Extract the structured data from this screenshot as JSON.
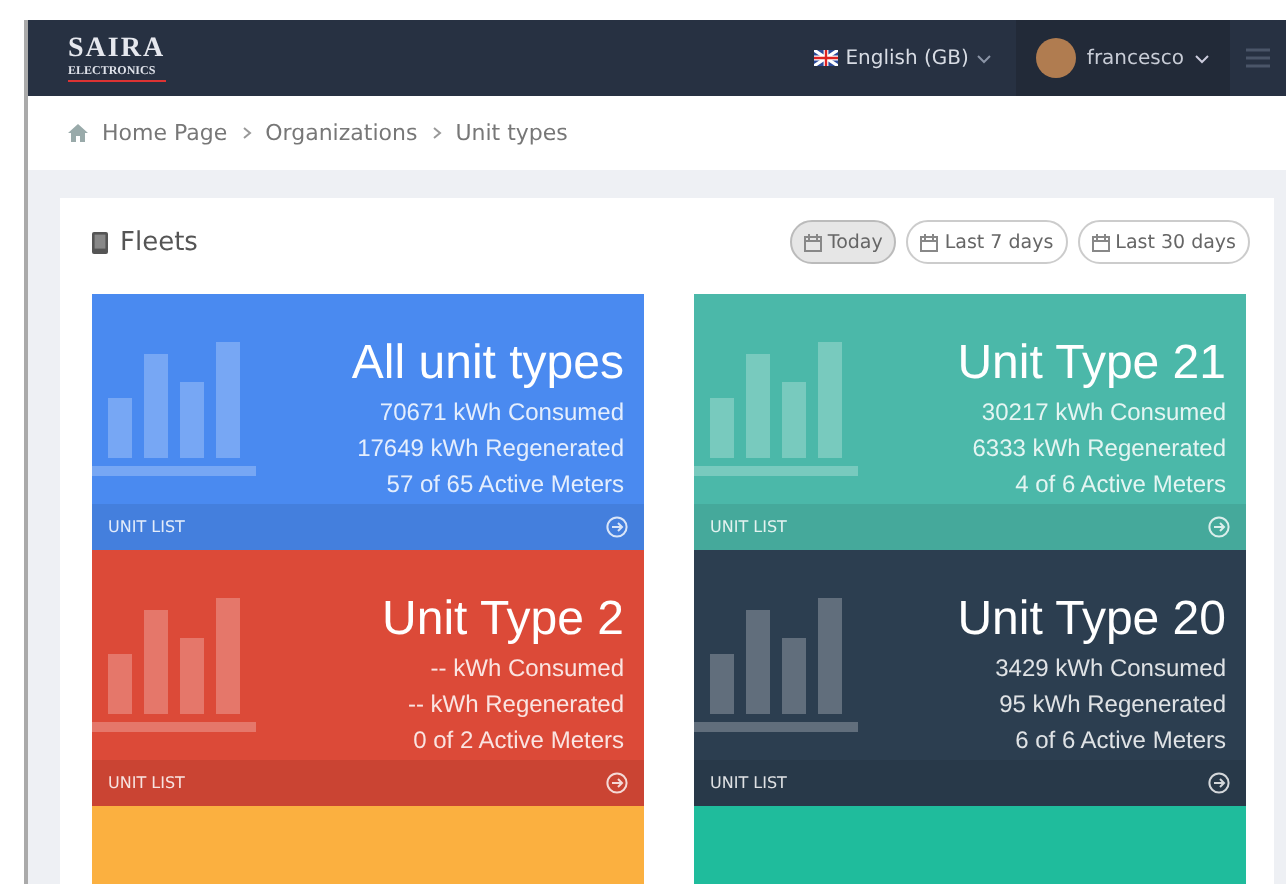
{
  "navbar": {
    "brand": "SAIRA",
    "brand_sub": "ELECTRONICS",
    "language": "English (GB)",
    "user": "francesco"
  },
  "breadcrumb": [
    "Home Page",
    "Organizations",
    "Unit types"
  ],
  "panel": {
    "title": "Fleets",
    "ranges": [
      {
        "label": "Today",
        "selected": true
      },
      {
        "label": "Last 7 days",
        "selected": false
      },
      {
        "label": "Last 30 days",
        "selected": false
      }
    ],
    "cards": [
      {
        "title": "All unit types",
        "lines": [
          "70671 kWh Consumed",
          "17649 kWh Regenerated",
          "57 of 65 Active Meters"
        ],
        "link": "UNIT LIST",
        "color": "#4a8af0"
      },
      {
        "title": "Unit Type 21",
        "lines": [
          "30217 kWh Consumed",
          "6333 kWh Regenerated",
          "4 of 6 Active Meters"
        ],
        "link": "UNIT LIST",
        "color": "#4bb8a9"
      },
      {
        "title": "Unit Type 2",
        "lines": [
          "-- kWh Consumed",
          "-- kWh Regenerated",
          "0 of 2 Active Meters"
        ],
        "link": "UNIT LIST",
        "color": "#dc4a38"
      },
      {
        "title": "Unit Type 20",
        "lines": [
          "3429 kWh Consumed",
          "95 kWh Regenerated",
          "6 of 6 Active Meters"
        ],
        "link": "UNIT LIST",
        "color": "#2c3e50"
      },
      {
        "color": "#fbb040"
      },
      {
        "color": "#1fbc9c"
      }
    ]
  }
}
